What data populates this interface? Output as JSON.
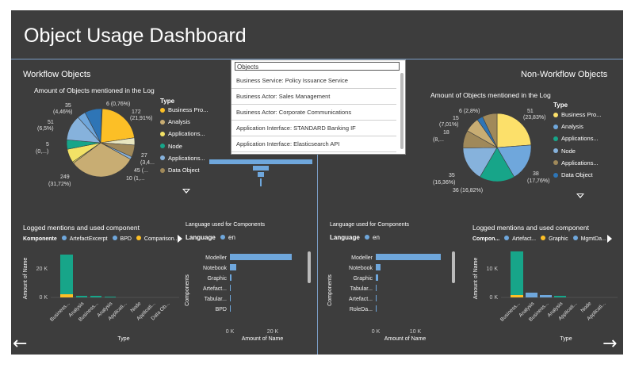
{
  "dashboard": {
    "title": "Object Usage Dashboard",
    "workflow_title": "Workflow Objects",
    "nonworkflow_title": "Non-Workflow Objects",
    "colors": {
      "bg": "#3d3d3d",
      "divider": "#7a9cc4",
      "bar_blue": "#6fa7dc",
      "bar_teal": "#17a589",
      "yellow": "#fcbf26"
    }
  },
  "objects_list": {
    "header": "Objects",
    "items": [
      "Business Service: Policy Issuance Service",
      "Business Actor: Sales Management",
      "Business Actor: Corporate Communications",
      "Application Interface: STANDARD Banking IF",
      "Application Interface: Elasticsearch API"
    ]
  },
  "left_pie": {
    "title": "Amount of Objects mentioned in the Log",
    "legend_title": "Type",
    "legend": [
      {
        "label": "Business Pro...",
        "color": "#fcbf26"
      },
      {
        "label": "Analysis",
        "color": "#c8ad73"
      },
      {
        "label": "Applications...",
        "color": "#f2e266"
      },
      {
        "label": "Node",
        "color": "#17a589"
      },
      {
        "label": "Applications...",
        "color": "#86b2dc"
      },
      {
        "label": "Data Object",
        "color": "#a0895a"
      }
    ],
    "slice_labels": [
      "6 (0,76%)",
      "172",
      "(21,91%)",
      "35",
      "(4,46%)",
      "51",
      "(6,5%)",
      "5",
      "(0,...)",
      "27",
      "(3,4...",
      "45 (...",
      "10 (1,...",
      "249",
      "(31,72%)"
    ]
  },
  "right_pie": {
    "title": "Amount of Objects mentioned in the Log",
    "legend_title": "Type",
    "legend": [
      {
        "label": "Business Pro...",
        "color": "#fce06a"
      },
      {
        "label": "Analysis",
        "color": "#6fa7dc"
      },
      {
        "label": "Applications...",
        "color": "#17a589"
      },
      {
        "label": "Node",
        "color": "#86b2dc"
      },
      {
        "label": "Applications...",
        "color": "#a0895a"
      },
      {
        "label": "Data Object",
        "color": "#2e75b6"
      }
    ],
    "slice_labels": [
      "6 (2,8%)",
      "15",
      "(7,01%)",
      "18",
      "(8,...",
      "51",
      "(23,83%)",
      "35",
      "(16,36%)",
      "38",
      "(17,76%)",
      "36 (16,82%)"
    ]
  },
  "left_bar": {
    "title": "Logged mentions and used component",
    "legend_title": "Komponente",
    "legend": [
      {
        "label": "ArtefactExcerpt",
        "color": "#6fa7dc"
      },
      {
        "label": "BPD",
        "color": "#6fa7dc"
      },
      {
        "label": "Comparison...",
        "color": "#fcbf26"
      }
    ],
    "ylabel": "Amount of Name",
    "xlabel": "Type",
    "yticks": [
      "20 K",
      "0 K"
    ],
    "categories": [
      "Business...",
      "Analysis",
      "Business...",
      "Analysis",
      "Applicati...",
      "Node",
      "Applicati...",
      "Data Ob..."
    ]
  },
  "left_lang": {
    "title": "Language used for Components",
    "legend_title": "Language",
    "legend": [
      {
        "label": "en",
        "color": "#6fa7dc"
      }
    ],
    "ylabel": "Components",
    "xlabel": "Amount of Name",
    "categories": [
      "Modeller",
      "Notebook",
      "Graphic",
      "Artefact...",
      "Tabular...",
      "BPD"
    ],
    "xticks": [
      "0 K",
      "20 K"
    ]
  },
  "right_lang": {
    "title": "Language used for Components",
    "legend_title": "Language",
    "legend": [
      {
        "label": "en",
        "color": "#6fa7dc"
      }
    ],
    "ylabel": "Components",
    "xlabel": "Amount of Name",
    "categories": [
      "Modeller",
      "Notebook",
      "Graphic",
      "Tabular...",
      "Artefact...",
      "RoleDa..."
    ],
    "xticks": [
      "0 K",
      "10 K"
    ]
  },
  "right_bar": {
    "title": "Logged mentions and used component",
    "legend_title": "Compon...",
    "legend": [
      {
        "label": "Artefact...",
        "color": "#6fa7dc"
      },
      {
        "label": "Graphic",
        "color": "#fcbf26"
      },
      {
        "label": "MgmtDa...",
        "color": "#6fa7dc"
      }
    ],
    "ylabel": "Amount of Name",
    "xlabel": "Type",
    "yticks": [
      "10 K",
      "0 K"
    ],
    "categories": [
      "Business...",
      "Analysis",
      "Business...",
      "Analysis",
      "Applicati...",
      "Node",
      "Applicati..."
    ]
  },
  "nav": {
    "prev": "←",
    "next": "→"
  }
}
